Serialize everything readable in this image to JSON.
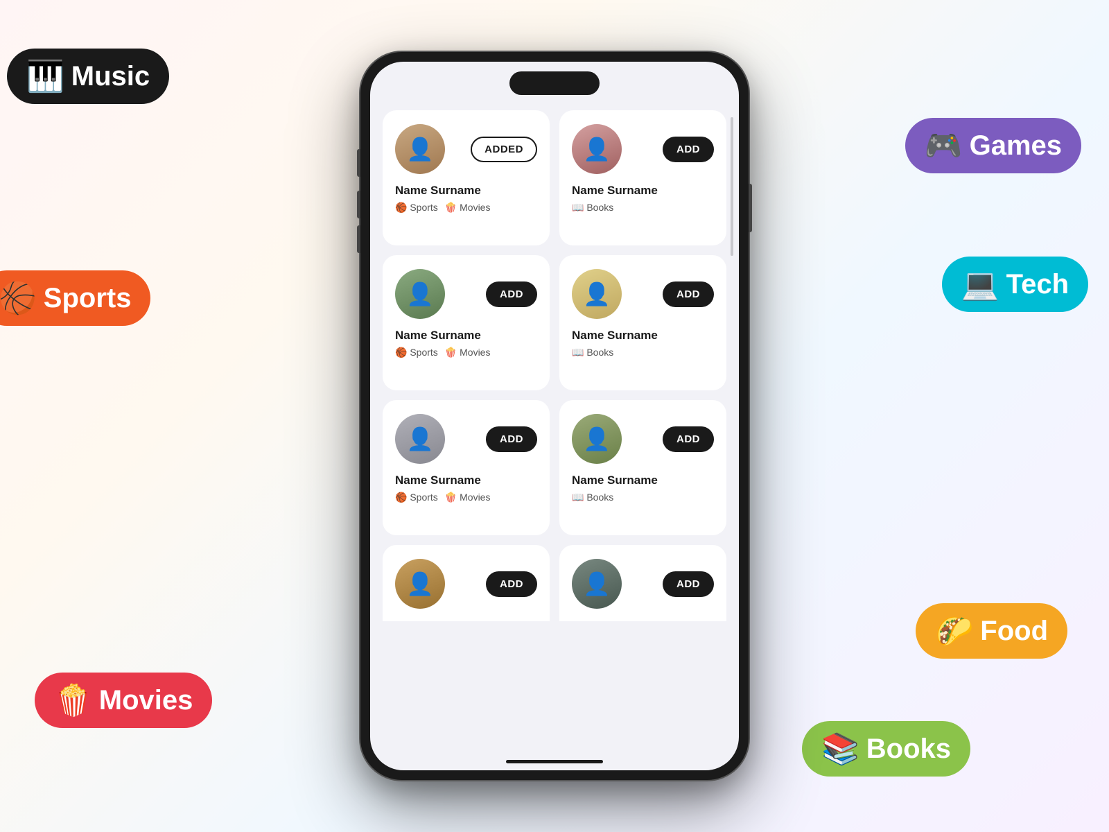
{
  "pills": [
    {
      "id": "music",
      "label": "Music",
      "icon": "🎹",
      "class": "pill-music"
    },
    {
      "id": "sports",
      "label": "Sports",
      "icon": "🏀",
      "class": "pill-sports"
    },
    {
      "id": "movies",
      "label": "Movies",
      "icon": "🍿",
      "class": "pill-movies"
    },
    {
      "id": "games",
      "label": "Games",
      "icon": "🎮",
      "class": "pill-games"
    },
    {
      "id": "tech",
      "label": "Tech",
      "icon": "💻",
      "class": "pill-tech"
    },
    {
      "id": "food",
      "label": "Food",
      "icon": "🌮",
      "class": "pill-food"
    },
    {
      "id": "books",
      "label": "Books",
      "icon": "📚",
      "class": "pill-books"
    }
  ],
  "cards": [
    {
      "row": 0,
      "left": {
        "name": "Name Surname",
        "avatar": "f1",
        "state": "added",
        "add_label": "ADDED",
        "interests": [
          {
            "icon": "🏀",
            "label": "Sports"
          },
          {
            "icon": "🍿",
            "label": "Movies"
          }
        ]
      },
      "right": {
        "name": "Name Surname",
        "avatar": "f2",
        "state": "add",
        "add_label": "ADD",
        "interests": [
          {
            "icon": "📖",
            "label": "Books"
          }
        ]
      }
    },
    {
      "row": 1,
      "left": {
        "name": "Name Surname",
        "avatar": "f3",
        "state": "add",
        "add_label": "ADD",
        "interests": [
          {
            "icon": "🏀",
            "label": "Sports"
          },
          {
            "icon": "🍿",
            "label": "Movies"
          }
        ]
      },
      "right": {
        "name": "Name Surname",
        "avatar": "f4",
        "state": "add",
        "add_label": "ADD",
        "interests": [
          {
            "icon": "📖",
            "label": "Books"
          }
        ]
      }
    },
    {
      "row": 2,
      "left": {
        "name": "Name Surname",
        "avatar": "f5",
        "state": "add",
        "add_label": "ADD",
        "interests": [
          {
            "icon": "🏀",
            "label": "Sports"
          },
          {
            "icon": "🍿",
            "label": "Movies"
          }
        ]
      },
      "right": {
        "name": "Name Surname",
        "avatar": "f6",
        "state": "add",
        "add_label": "ADD",
        "interests": [
          {
            "icon": "📖",
            "label": "Books"
          }
        ]
      }
    },
    {
      "row": 3,
      "left": {
        "name": "",
        "avatar": "f7",
        "state": "add",
        "add_label": "ADD",
        "interests": []
      },
      "right": {
        "name": "",
        "avatar": "f8",
        "state": "add",
        "add_label": "ADD",
        "interests": []
      }
    }
  ]
}
